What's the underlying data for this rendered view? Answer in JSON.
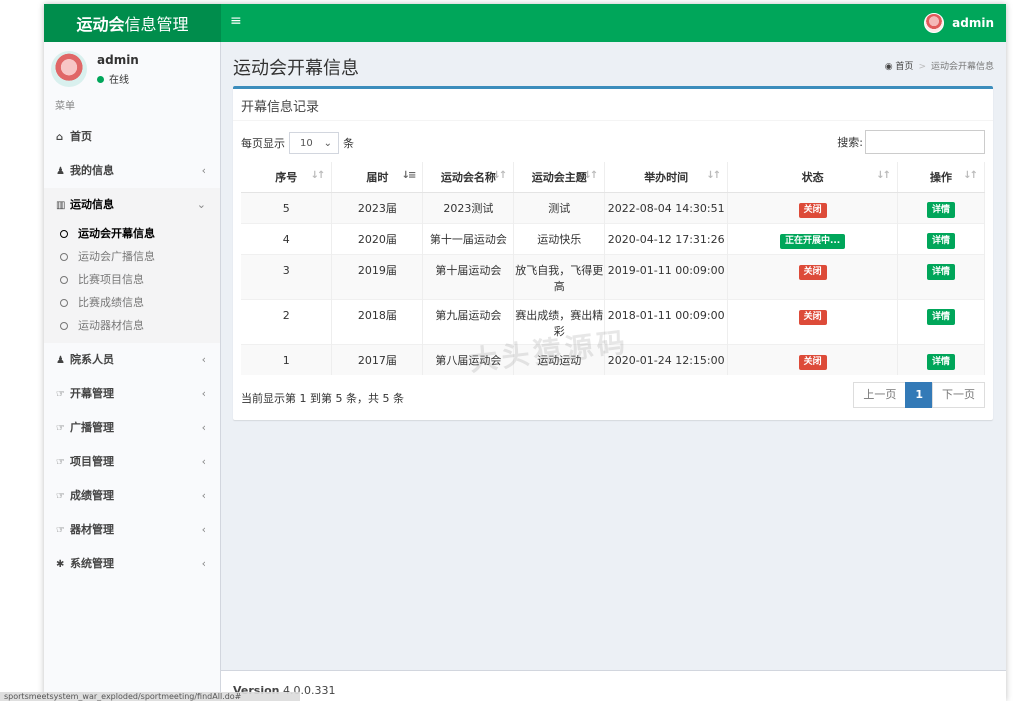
{
  "header": {
    "logo_bold": "运动会",
    "logo_rest": "信息管理",
    "toggle_icon": "≡",
    "username": "admin"
  },
  "sidebar": {
    "user_name": "admin",
    "user_status": "在线",
    "menu_header": "菜单",
    "items": [
      {
        "label": "首页",
        "icon": "home-icon"
      },
      {
        "label": "我的信息",
        "icon": "user-icon"
      },
      {
        "label": "运动信息",
        "icon": "bar-chart-icon"
      },
      {
        "label": "院系人员",
        "icon": "users-icon"
      },
      {
        "label": "开幕管理",
        "icon": "hand-pointer-icon"
      },
      {
        "label": "广播管理",
        "icon": "hand-pointer-icon"
      },
      {
        "label": "项目管理",
        "icon": "hand-pointer-icon"
      },
      {
        "label": "成绩管理",
        "icon": "hand-pointer-icon"
      },
      {
        "label": "器材管理",
        "icon": "hand-pointer-icon"
      },
      {
        "label": "系统管理",
        "icon": "gear-icon"
      }
    ],
    "submenu": [
      "运动会开幕信息",
      "运动会广播信息",
      "比赛项目信息",
      "比赛成绩信息",
      "运动器材信息"
    ]
  },
  "content": {
    "page_title": "运动会开幕信息",
    "breadcrumb": {
      "home": "首页",
      "current": "运动会开幕信息"
    }
  },
  "box": {
    "title": "开幕信息记录",
    "length_prefix": "每页显示",
    "length_value": "10",
    "length_suffix": "条",
    "search_label": "搜索:",
    "columns": [
      "序号",
      "届时",
      "运动会名称",
      "运动会主题",
      "举办时间",
      "状态",
      "操作"
    ],
    "rows": [
      {
        "no": "5",
        "session": "2023届",
        "name": "2023测试",
        "theme": "测试",
        "time": "2022-08-04 14:30:51",
        "status": "关闭",
        "status_color": "#dd4b39",
        "action": "详情"
      },
      {
        "no": "4",
        "session": "2020届",
        "name": "第十一届运动会",
        "theme": "运动快乐",
        "time": "2020-04-12 17:31:26",
        "status": "正在开展中...",
        "status_color": "#00a65a",
        "action": "详情"
      },
      {
        "no": "3",
        "session": "2019届",
        "name": "第十届运动会",
        "theme": "放飞自我，飞得更高",
        "time": "2019-01-11 00:09:00",
        "status": "关闭",
        "status_color": "#dd4b39",
        "action": "详情"
      },
      {
        "no": "2",
        "session": "2018届",
        "name": "第九届运动会",
        "theme": "赛出成绩，赛出精彩",
        "time": "2018-01-11 00:09:00",
        "status": "关闭",
        "status_color": "#dd4b39",
        "action": "详情"
      },
      {
        "no": "1",
        "session": "2017届",
        "name": "第八届运动会",
        "theme": "运动运动",
        "time": "2020-01-24 12:15:00",
        "status": "关闭",
        "status_color": "#dd4b39",
        "action": "详情"
      }
    ],
    "info": "当前显示第 1 到第 5 条，共 5 条",
    "pager": {
      "prev": "上一页",
      "current": "1",
      "next": "下一页"
    }
  },
  "footer": {
    "version_label": "Version",
    "version": "4.0.0.331"
  },
  "watermark": "大头猿源码",
  "status_url": "sportsmeetsystem_war_exploded/sportmeeting/findAll.do#"
}
